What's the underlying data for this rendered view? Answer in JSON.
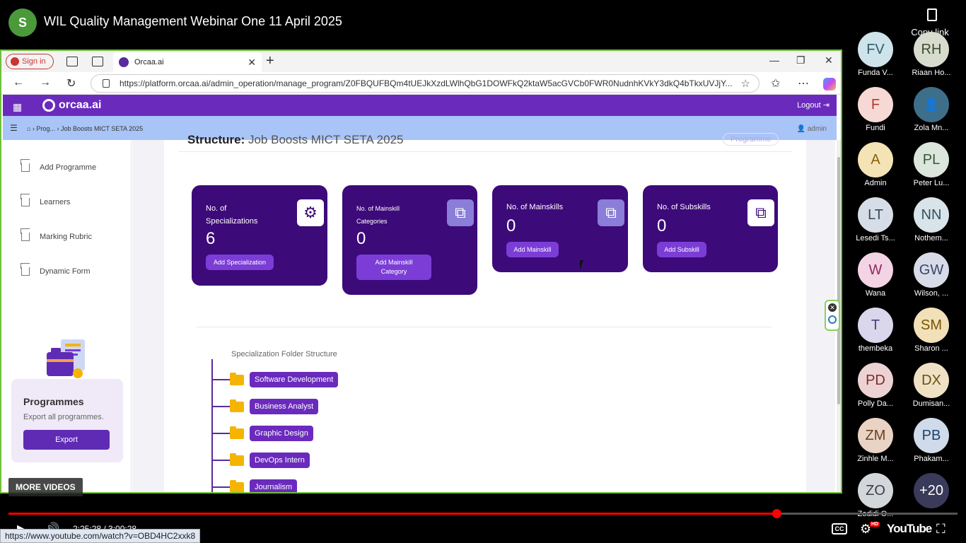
{
  "video": {
    "channel_initial": "S",
    "title": "WIL Quality Management Webinar One 11 April 2025",
    "copy_link": "Copy link",
    "more_videos": "MORE VIDEOS",
    "progress": 0.8095,
    "timecode": "2:25:28 / 3:00:28",
    "status_url": "https://www.youtube.com/watch?v=OBD4HC2xxk8",
    "youtube_label": "YouTube",
    "cc_label": "CC",
    "hd_label": "HD"
  },
  "browser": {
    "sign_in": "Sign in",
    "tab_title": "Orcaa.ai",
    "url": "https://platform.orcaa.ai/admin_operation/manage_program/Z0FBQUFBQm4tUEJkXzdLWlhQbG1DOWFkQ2ktaW5acGVCb0FWR0NudnhKVkY3dkQ4bTkxUVJjY..."
  },
  "app": {
    "logo": "orcaa.ai",
    "logout": "Logout",
    "breadcrumb": "› Prog... › Job Boosts MICT SETA 2025",
    "user": "admin",
    "sidebar": [
      {
        "label": "Add Programme"
      },
      {
        "label": "Learners"
      },
      {
        "label": "Marking Rubric"
      },
      {
        "label": "Dynamic Form"
      }
    ],
    "programmes_card": {
      "title": "Programmes",
      "subtitle": "Export all programmes.",
      "button": "Export"
    },
    "structure_label": "Structure:",
    "structure_name": "Job Boosts MICT SETA 2025",
    "programme_badge": "Programme",
    "cards": [
      {
        "label": "No. of Specializations",
        "value": "6",
        "button": "Add Specialization"
      },
      {
        "label": "No. of Mainskill Categories",
        "value": "0",
        "button": "Add Mainskill Category"
      },
      {
        "label": "No. of Mainskills",
        "value": "0",
        "button": "Add Mainskill"
      },
      {
        "label": "No. of Subskills",
        "value": "0",
        "button": "Add Subskill"
      }
    ],
    "tree_title": "Specialization Folder Structure",
    "tree_items": [
      "Software Development",
      "Business Analyst",
      "Graphic Design",
      "DevOps Intern",
      "Journalism"
    ]
  },
  "participants": [
    {
      "initials": "FV",
      "name": "Funda V...",
      "bg": "#cfe3ea",
      "fg": "#2b5c6d"
    },
    {
      "initials": "RH",
      "name": "Riaan Ho...",
      "bg": "#d7dccf",
      "fg": "#3d4b2c"
    },
    {
      "initials": "F",
      "name": "Fundi",
      "bg": "#f6d8d4",
      "fg": "#b3392b"
    },
    {
      "initials": "",
      "name": "Zola Mn...",
      "bg": "#3d6f8a",
      "fg": "#ffffff"
    },
    {
      "initials": "A",
      "name": "Admin",
      "bg": "#f3e3b5",
      "fg": "#8a6208"
    },
    {
      "initials": "PL",
      "name": "Peter Lu...",
      "bg": "#dce6dc",
      "fg": "#38573a"
    },
    {
      "initials": "LT",
      "name": "Lesedi Ts...",
      "bg": "#d6dde6",
      "fg": "#36495e"
    },
    {
      "initials": "NN",
      "name": "Nothem...",
      "bg": "#d9e4ea",
      "fg": "#34505e"
    },
    {
      "initials": "W",
      "name": "Wana",
      "bg": "#f2d4e4",
      "fg": "#94285e"
    },
    {
      "initials": "GW",
      "name": "Wilson, ...",
      "bg": "#d8dce8",
      "fg": "#3a4668"
    },
    {
      "initials": "T",
      "name": "thembeka",
      "bg": "#dad6ec",
      "fg": "#4a3f7a"
    },
    {
      "initials": "SM",
      "name": "Sharon ...",
      "bg": "#f2e0b8",
      "fg": "#7a5400"
    },
    {
      "initials": "PD",
      "name": "Polly Da...",
      "bg": "#ecd2d2",
      "fg": "#7a2c2c"
    },
    {
      "initials": "DX",
      "name": "Dumisan...",
      "bg": "#efe1c4",
      "fg": "#6a4f12"
    },
    {
      "initials": "ZM",
      "name": "Zinhle M...",
      "bg": "#e8d3c4",
      "fg": "#6d3f22"
    },
    {
      "initials": "PB",
      "name": "Phakam...",
      "bg": "#cfdbea",
      "fg": "#1f3f6e"
    },
    {
      "initials": "ZO",
      "name": "Zodidi O...",
      "bg": "#d3d6da",
      "fg": "#3c4046"
    },
    {
      "initials": "+20",
      "name": "",
      "bg": "#3a3a5a",
      "fg": "#ffffff"
    }
  ]
}
